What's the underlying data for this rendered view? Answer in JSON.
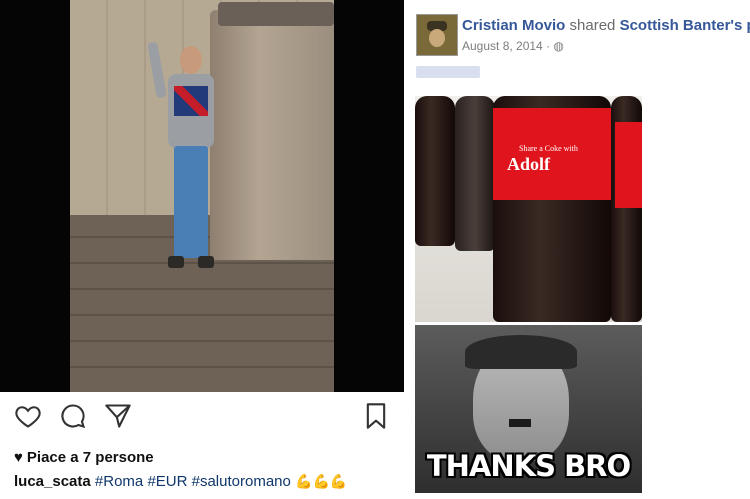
{
  "instagram": {
    "likes_text": "Piace a 7 persone",
    "caption": {
      "username": "luca_scata",
      "hashtags": [
        "#Roma",
        "#EUR",
        "#salutoromano"
      ],
      "emoji": "💪💪💪"
    },
    "icons": [
      "heart-icon",
      "comment-icon",
      "share-icon",
      "bookmark-icon"
    ]
  },
  "facebook": {
    "author": "Cristian Movio",
    "action": "shared",
    "source": "Scottish Banter's pho",
    "date": "August 8, 2014 · ",
    "bottle_label_small": "Share a Coke with",
    "bottle_label_name": "Adolf",
    "meme_caption": "THANKS BRO"
  },
  "colors": {
    "fb_link": "#365899",
    "ig_hashtag": "#10376b",
    "coke_red": "#e0141c"
  }
}
